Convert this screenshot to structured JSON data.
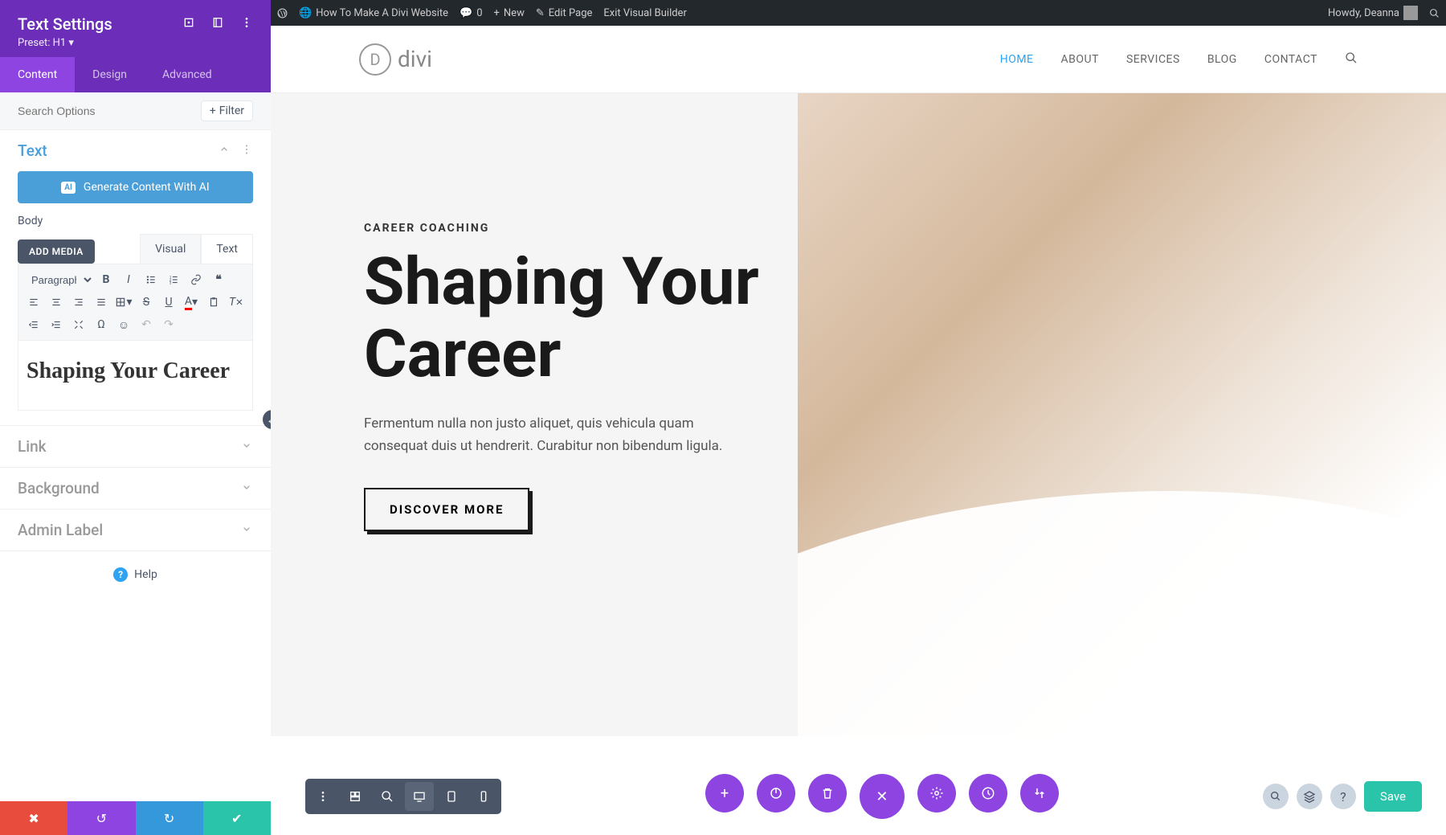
{
  "adminBar": {
    "siteName": "How To Make A Divi Website",
    "comments": "0",
    "new": "New",
    "editPage": "Edit Page",
    "exitBuilder": "Exit Visual Builder",
    "howdy": "Howdy, Deanna"
  },
  "sidebar": {
    "title": "Text Settings",
    "preset": "Preset: H1",
    "tabs": {
      "content": "Content",
      "design": "Design",
      "advanced": "Advanced"
    },
    "searchPlaceholder": "Search Options",
    "filter": "Filter",
    "sections": {
      "text": "Text",
      "link": "Link",
      "background": "Background",
      "adminLabel": "Admin Label"
    },
    "aiButton": "Generate Content With AI",
    "bodyLabel": "Body",
    "addMedia": "ADD MEDIA",
    "editorTabs": {
      "visual": "Visual",
      "text": "Text"
    },
    "formatSelect": "Paragraph",
    "editorContent": "Shaping Your Career",
    "help": "Help"
  },
  "nav": {
    "logoText": "divi",
    "items": [
      "HOME",
      "ABOUT",
      "SERVICES",
      "BLOG",
      "CONTACT"
    ]
  },
  "hero": {
    "eyebrow": "CAREER COACHING",
    "title": "Shaping Your Career",
    "desc": "Fermentum nulla non justo aliquet, quis vehicula quam consequat duis ut hendrerit. Curabitur non bibendum ligula.",
    "cta": "DISCOVER MORE"
  },
  "bottomBar": {
    "save": "Save"
  }
}
